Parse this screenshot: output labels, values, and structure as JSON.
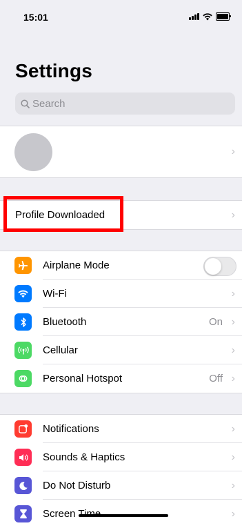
{
  "status_bar": {
    "time": "15:01",
    "icons": [
      "signal-icon",
      "wifi-icon",
      "battery-icon"
    ]
  },
  "header": {
    "title": "Settings"
  },
  "search": {
    "placeholder": "Search"
  },
  "profile": {
    "avatar": "avatar-placeholder"
  },
  "profile_downloaded": {
    "label": "Profile Downloaded"
  },
  "connectivity": [
    {
      "label": "Airplane Mode",
      "icon": "airplane-icon",
      "color": "#ff9500",
      "toggle": false
    },
    {
      "label": "Wi-Fi",
      "icon": "wifi-icon",
      "color": "#007aff"
    },
    {
      "label": "Bluetooth",
      "icon": "bluetooth-icon",
      "color": "#007aff",
      "value": "On"
    },
    {
      "label": "Cellular",
      "icon": "cellular-icon",
      "color": "#4cd964"
    },
    {
      "label": "Personal Hotspot",
      "icon": "hotspot-icon",
      "color": "#4cd964",
      "value": "Off"
    }
  ],
  "notifications_group": [
    {
      "label": "Notifications",
      "icon": "notifications-icon",
      "color": "#ff3b30"
    },
    {
      "label": "Sounds & Haptics",
      "icon": "sounds-icon",
      "color": "#ff2d55"
    },
    {
      "label": "Do Not Disturb",
      "icon": "moon-icon",
      "color": "#5856d6"
    },
    {
      "label": "Screen Time",
      "icon": "hourglass-icon",
      "color": "#5856d6"
    }
  ],
  "chevron": "›",
  "highlight_color": "#ff0000"
}
